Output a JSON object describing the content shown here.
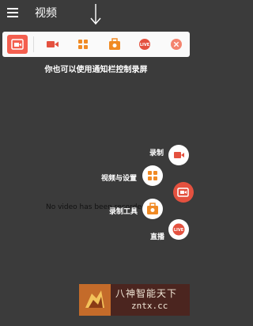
{
  "header": {
    "title": "视频"
  },
  "hint": "你也可以使用通知栏控制录屏",
  "empty_text": "No video has been recorded",
  "fab_menu": {
    "record_label": "录制",
    "video_settings_label": "视频与设置",
    "tools_label": "录制工具",
    "live_label": "直播"
  },
  "toolbar": {
    "live_badge": "LIVE"
  },
  "watermark": {
    "line1": "八神智能天下",
    "line2": "zntx.cc"
  },
  "colors": {
    "accent": "#e4513f",
    "orange": "#f08a24",
    "background": "#3b3b3b"
  }
}
